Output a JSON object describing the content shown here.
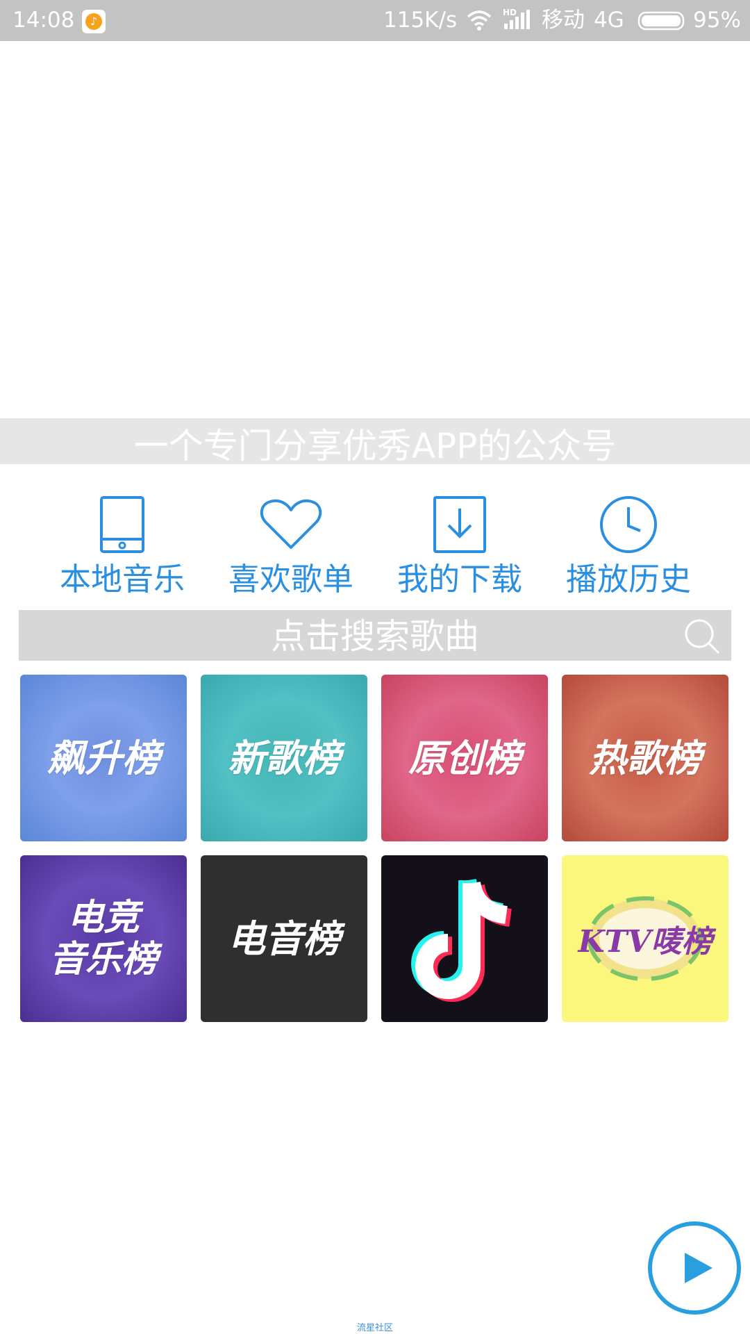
{
  "status_bar": {
    "time": "14:08",
    "speed": "115K/s",
    "carrier": "移动",
    "network": "4G",
    "battery": "95%",
    "icons": [
      "music-app-icon",
      "wifi-icon",
      "hd-signal-icon",
      "battery-icon"
    ]
  },
  "banner": {
    "caption": "一个专门分享优秀APP的公众号"
  },
  "quick_actions": [
    {
      "label": "本地音乐",
      "icon": "tablet-icon"
    },
    {
      "label": "喜欢歌单",
      "icon": "heart-icon"
    },
    {
      "label": "我的下载",
      "icon": "download-icon"
    },
    {
      "label": "播放历史",
      "icon": "clock-icon"
    }
  ],
  "search": {
    "placeholder": "点击搜索歌曲",
    "icon": "search-icon"
  },
  "charts": [
    {
      "title": "飙升榜"
    },
    {
      "title": "新歌榜"
    },
    {
      "title": "原创榜"
    },
    {
      "title": "热歌榜"
    },
    {
      "title_line1": "电竞",
      "title_line2": "音乐榜"
    },
    {
      "title": "电音榜"
    },
    {
      "icon": "tiktok-logo-icon"
    },
    {
      "title": "KTV唛榜",
      "icon": "ktv-logo-icon"
    }
  ],
  "player": {
    "icon": "play-icon"
  },
  "footer": {
    "text": "流星社区"
  },
  "colors": {
    "accent": "#2a8fe0",
    "status_bar": "#c3c3c3",
    "search_bg": "#d7d7d7",
    "caption_bg": "#e6e6e6"
  }
}
